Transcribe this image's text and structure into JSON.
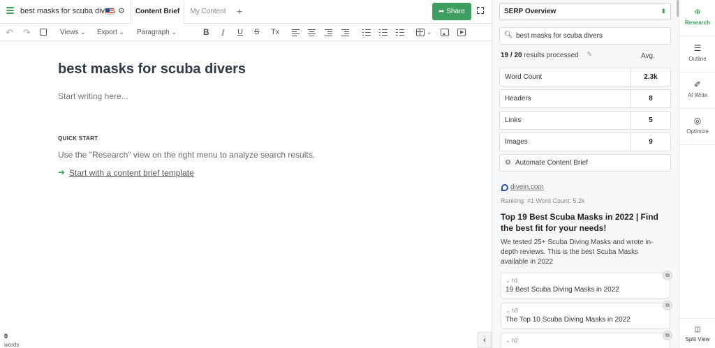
{
  "header": {
    "doc_title": "best masks for scuba divers",
    "tabs": [
      {
        "label": "Content Brief",
        "active": true
      },
      {
        "label": "My Content",
        "active": false
      }
    ],
    "add_tab": "+",
    "share_label": "Share",
    "share_color": "#3d9f5f",
    "icons": {
      "menu": "hamburger-icon",
      "flag": "us-flag-icon",
      "settings": "gear-icon",
      "share": "share-arrow-icon",
      "fullscreen": "expand-icon"
    }
  },
  "toolbar": {
    "undo": "↶",
    "redo": "↷",
    "views_label": "Views",
    "export_label": "Export",
    "format_label": "Paragraph",
    "bold": "B",
    "italic": "I",
    "underline": "U",
    "strike": "S",
    "clear_format": "Tx"
  },
  "editor": {
    "heading": "best masks for scuba divers",
    "placeholder": "Start writing here...",
    "quick_start_label": "QUICK START",
    "quick_start_text": "Use the \"Research\" view on the right menu to analyze search results.",
    "arrow": "➔",
    "template_link": "Start with a content brief template",
    "word_count": "0",
    "word_label": "words",
    "collapse": "‹"
  },
  "research": {
    "view_select": "SERP Overview",
    "search_query": "best masks for scuba divers",
    "processed_count": "19 / 20",
    "processed_label": " results processed",
    "avg_label": "Avg.",
    "metrics": [
      {
        "name": "Word Count",
        "value": "2.3k"
      },
      {
        "name": "Headers",
        "value": "8"
      },
      {
        "name": "Links",
        "value": "5"
      },
      {
        "name": "Images",
        "value": "9"
      }
    ],
    "automate_label": "Automate Content Brief",
    "result": {
      "domain": "divein.com",
      "ranking": "Ranking: #1   Word Count: 5.2k",
      "title": "Top 19 Best Scuba Masks in 2022 | Find the best fit for your needs!",
      "description": "We tested 25+ Scuba Diving Masks and wrote in-depth reviews. This is the best Scuba Masks available in 2022",
      "headings": [
        {
          "tag": "h1",
          "text": "19 Best Scuba Diving Masks in 2022"
        },
        {
          "tag": "h3",
          "text": "The Top 10 Scuba Diving Masks in 2022"
        },
        {
          "tag": "h2",
          "text": ""
        }
      ]
    }
  },
  "rail": {
    "items": [
      {
        "label": "Research",
        "icon": "binoculars-icon",
        "active": true
      },
      {
        "label": "Outline",
        "icon": "outline-icon",
        "active": false
      },
      {
        "label": "AI Write",
        "icon": "magic-wand-icon",
        "active": false
      },
      {
        "label": "Optimize",
        "icon": "target-icon",
        "active": false
      }
    ],
    "split_view_label": "Split View",
    "accent": "#3aa05a"
  }
}
